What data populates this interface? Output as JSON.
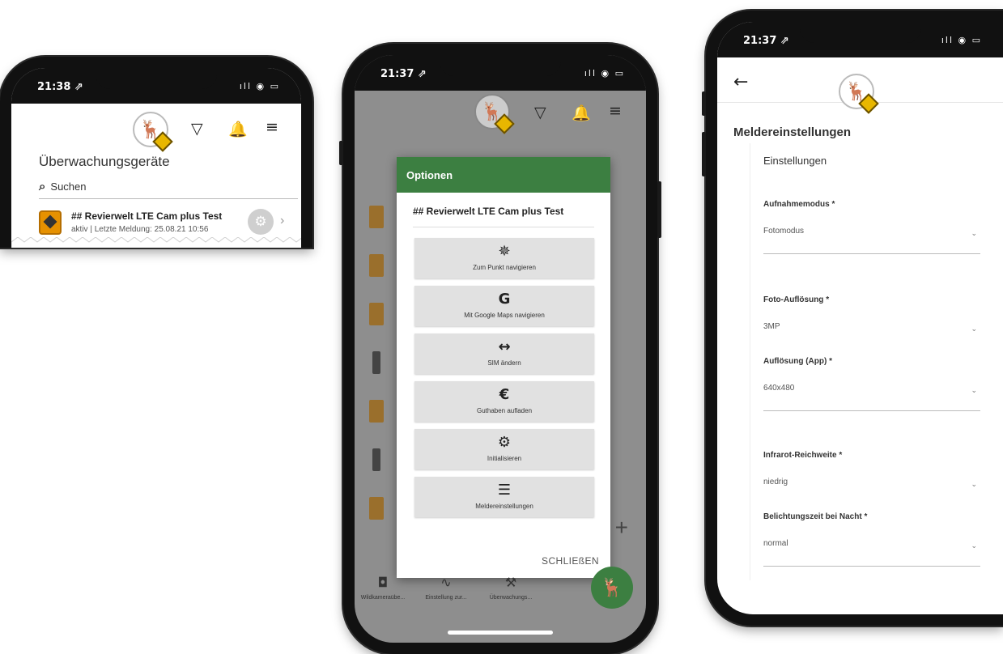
{
  "phone1": {
    "status": {
      "time": "21:38 ⇗",
      "sys": "ıll ◉ ▭"
    },
    "page_title": "Überwachungsgeräte",
    "search_placeholder": "Suchen",
    "device": {
      "name": "## Revierwelt LTE Cam plus Test",
      "status": "aktiv | Letzte Meldung: 25.08.21 10:56"
    }
  },
  "phone2": {
    "status": {
      "time": "21:37 ⇗",
      "sys": "ıll ◉ ▭"
    },
    "dialog": {
      "title": "Optionen",
      "device_name": "## Revierwelt LTE Cam plus Test",
      "options": [
        {
          "icon": "crosshair-icon",
          "glyph": "✵",
          "label": "Zum Punkt navigieren"
        },
        {
          "icon": "google-icon",
          "glyph": "G",
          "label": "Mit Google Maps navigieren"
        },
        {
          "icon": "swap-arrows-icon",
          "glyph": "↔",
          "label": "SIM ändern"
        },
        {
          "icon": "euro-icon",
          "glyph": "€",
          "label": "Guthaben aufladen"
        },
        {
          "icon": "gear-icon",
          "glyph": "⚙",
          "label": "Initialisieren"
        },
        {
          "icon": "sliders-icon",
          "glyph": "☰",
          "label": "Meldereinstellungen"
        }
      ],
      "close_label": "SCHLIEßEN"
    },
    "bottom_nav": [
      {
        "icon": "camera-icon",
        "glyph": "◘",
        "label": "Wildkameraübe..."
      },
      {
        "icon": "waveform-icon",
        "glyph": "∿",
        "label": "Einstellung zur..."
      },
      {
        "icon": "wrench-icon",
        "glyph": "⚒",
        "label": "Überwachungs..."
      }
    ]
  },
  "phone3": {
    "status": {
      "time": "21:37 ⇗",
      "sys": "ıll ◉ ▭"
    },
    "page_title": "Meldereinstellungen",
    "section_title": "Einstellungen",
    "fields": [
      {
        "label": "Aufnahmemodus *",
        "value": "Fotomodus"
      },
      {
        "label": "Foto-Auflösung *",
        "value": "3MP"
      },
      {
        "label": "Auflösung (App) *",
        "value": "640x480"
      },
      {
        "label": "Infrarot-Reichweite *",
        "value": "niedrig"
      },
      {
        "label": "Belichtungszeit bei Nacht *",
        "value": "normal"
      }
    ]
  },
  "colors": {
    "accent_green": "#3c7f41",
    "cam_orange": "#e69100"
  }
}
